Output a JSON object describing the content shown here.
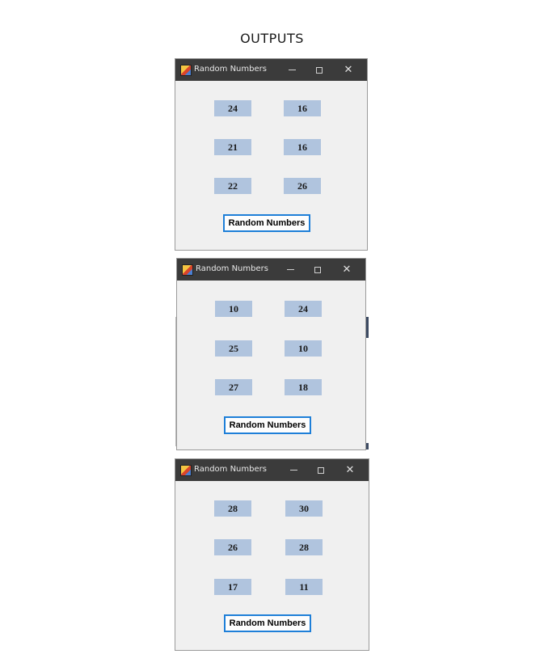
{
  "heading": "OUTPUTS",
  "windows": [
    {
      "title": "Random Numbers",
      "numbers": [
        "24",
        "16",
        "21",
        "16",
        "22",
        "26"
      ],
      "button_label": "Random Numbers"
    },
    {
      "title": "Random Numbers",
      "numbers": [
        "10",
        "24",
        "25",
        "10",
        "27",
        "18"
      ],
      "button_label": "Random Numbers"
    },
    {
      "title": "Random Numbers",
      "numbers": [
        "28",
        "30",
        "26",
        "28",
        "17",
        "11"
      ],
      "button_label": "Random Numbers"
    }
  ],
  "controls": {
    "minimize_icon": "minimize-icon",
    "maximize_icon": "maximize-icon",
    "close_icon": "close-icon",
    "close_glyph": "✕"
  },
  "colors": {
    "titlebar": "#3b3b3b",
    "client": "#f0f0f0",
    "number_box": "#b0c4de",
    "button_border": "#1e7fd8"
  }
}
